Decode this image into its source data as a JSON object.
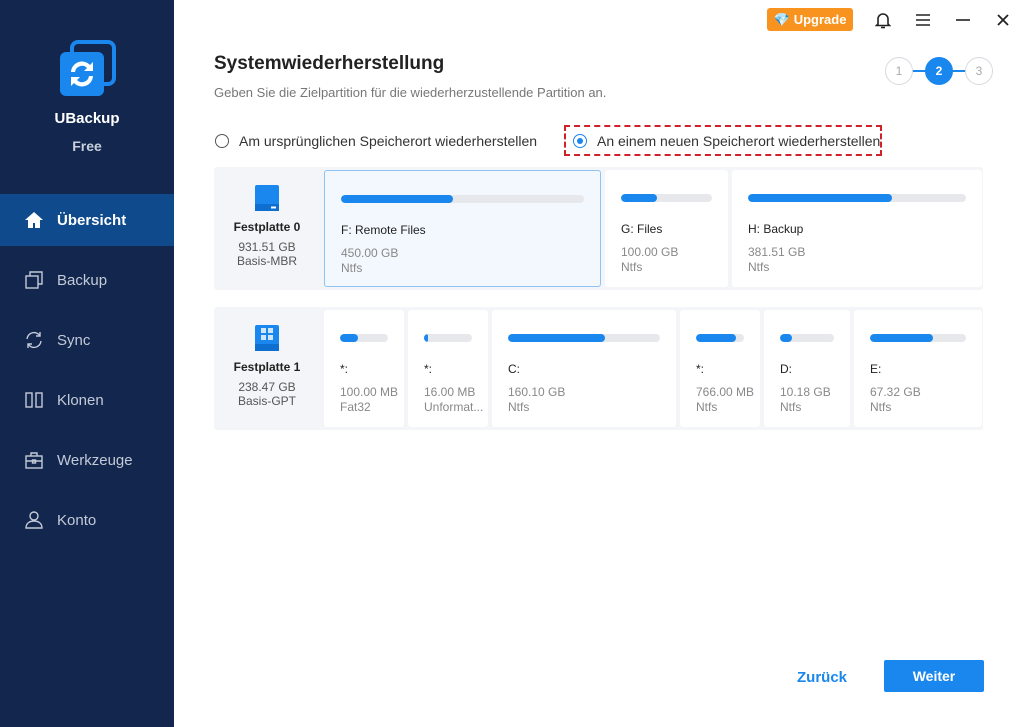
{
  "app": {
    "name": "UBackup",
    "edition": "Free"
  },
  "sidebar": {
    "items": [
      {
        "label": "Übersicht",
        "icon": "home-icon",
        "active": true
      },
      {
        "label": "Backup",
        "icon": "backup-icon"
      },
      {
        "label": "Sync",
        "icon": "sync-icon"
      },
      {
        "label": "Klonen",
        "icon": "clone-icon"
      },
      {
        "label": "Werkzeuge",
        "icon": "toolbox-icon"
      },
      {
        "label": "Konto",
        "icon": "user-icon"
      }
    ]
  },
  "topbar": {
    "upgrade": "Upgrade"
  },
  "page": {
    "title": "Systemwiederherstellung",
    "subtitle": "Geben Sie die Zielpartition für die wiederherzustellende Partition an.",
    "steps": [
      "1",
      "2",
      "3"
    ],
    "current_step": 2,
    "options": [
      {
        "label": "Am ursprünglichen Speicherort wiederherstellen",
        "selected": false
      },
      {
        "label": "An einem neuen Speicherort wiederherstellen",
        "selected": true
      }
    ]
  },
  "disks": [
    {
      "name": "Festplatte 0",
      "size": "931.51 GB",
      "type": "Basis-MBR",
      "icon": "hdd-icon",
      "partitions": [
        {
          "label": "F: Remote Files",
          "size": "450.00 GB",
          "fs": "Ntfs",
          "used_pct": 46,
          "selected": true
        },
        {
          "label": "G: Files",
          "size": "100.00 GB",
          "fs": "Ntfs",
          "used_pct": 40
        },
        {
          "label": "H: Backup",
          "size": "381.51 GB",
          "fs": "Ntfs",
          "used_pct": 66
        }
      ]
    },
    {
      "name": "Festplatte 1",
      "size": "238.47 GB",
      "type": "Basis-GPT",
      "icon": "system-disk-icon",
      "partitions": [
        {
          "label": "*:",
          "size": "100.00 MB",
          "fs": "Fat32",
          "used_pct": 38
        },
        {
          "label": "*:",
          "size": "16.00 MB",
          "fs": "Unformat...",
          "used_pct": 8
        },
        {
          "label": "C:",
          "size": "160.10 GB",
          "fs": "Ntfs",
          "used_pct": 64
        },
        {
          "label": "*:",
          "size": "766.00 MB",
          "fs": "Ntfs",
          "used_pct": 83
        },
        {
          "label": "D:",
          "size": "10.18 GB",
          "fs": "Ntfs",
          "used_pct": 22
        },
        {
          "label": "E:",
          "size": "67.32 GB",
          "fs": "Ntfs",
          "used_pct": 66
        }
      ]
    }
  ],
  "footer": {
    "back": "Zurück",
    "next": "Weiter"
  },
  "colors": {
    "accent": "#1a87ef",
    "sidebar": "#13264d",
    "active": "#0e4a8c",
    "upgrade": "#f7931e",
    "highlight": "#d0202a"
  }
}
